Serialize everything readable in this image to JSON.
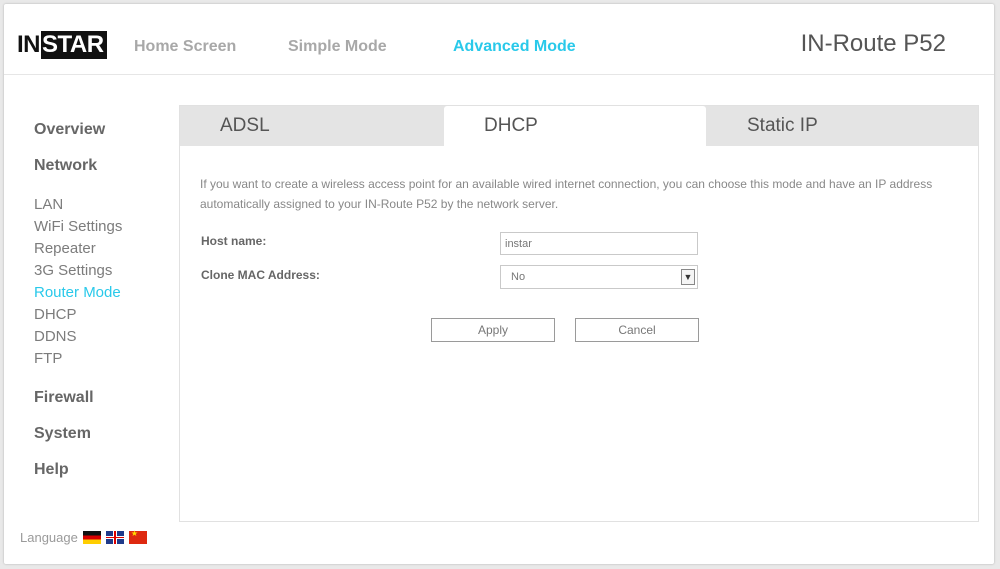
{
  "logo": {
    "in": "IN",
    "star": "STAR"
  },
  "topnav": [
    {
      "label": "Home Screen",
      "active": false
    },
    {
      "label": "Simple Mode",
      "active": false
    },
    {
      "label": "Advanced Mode",
      "active": true
    }
  ],
  "model": "IN-Route P52",
  "sidebar": {
    "overview": "Overview",
    "network": "Network",
    "network_items": [
      "LAN",
      "WiFi Settings",
      "Repeater",
      "3G Settings",
      "Router Mode",
      "DHCP",
      "DDNS",
      "FTP"
    ],
    "active_item": "Router Mode",
    "firewall": "Firewall",
    "system": "System",
    "help": "Help"
  },
  "language": {
    "label": "Language",
    "flags": [
      "flag-de-icon",
      "flag-uk-icon",
      "flag-cn-icon"
    ]
  },
  "tabs": [
    {
      "label": "ADSL",
      "active": false
    },
    {
      "label": "DHCP",
      "active": true
    },
    {
      "label": "Static IP",
      "active": false
    }
  ],
  "description": "If you want to create a wireless access point for an available wired internet connection, you can choose this mode and have an IP address automatically assigned to your IN-Route P52 by the network server.",
  "form": {
    "host_label": "Host name:",
    "host_value": "instar",
    "clone_label": "Clone MAC Address:",
    "clone_value": "No",
    "apply": "Apply",
    "cancel": "Cancel"
  },
  "colors": {
    "accent": "#29c9ea",
    "text": "#666666",
    "tab_bg": "#e4e4e4"
  }
}
